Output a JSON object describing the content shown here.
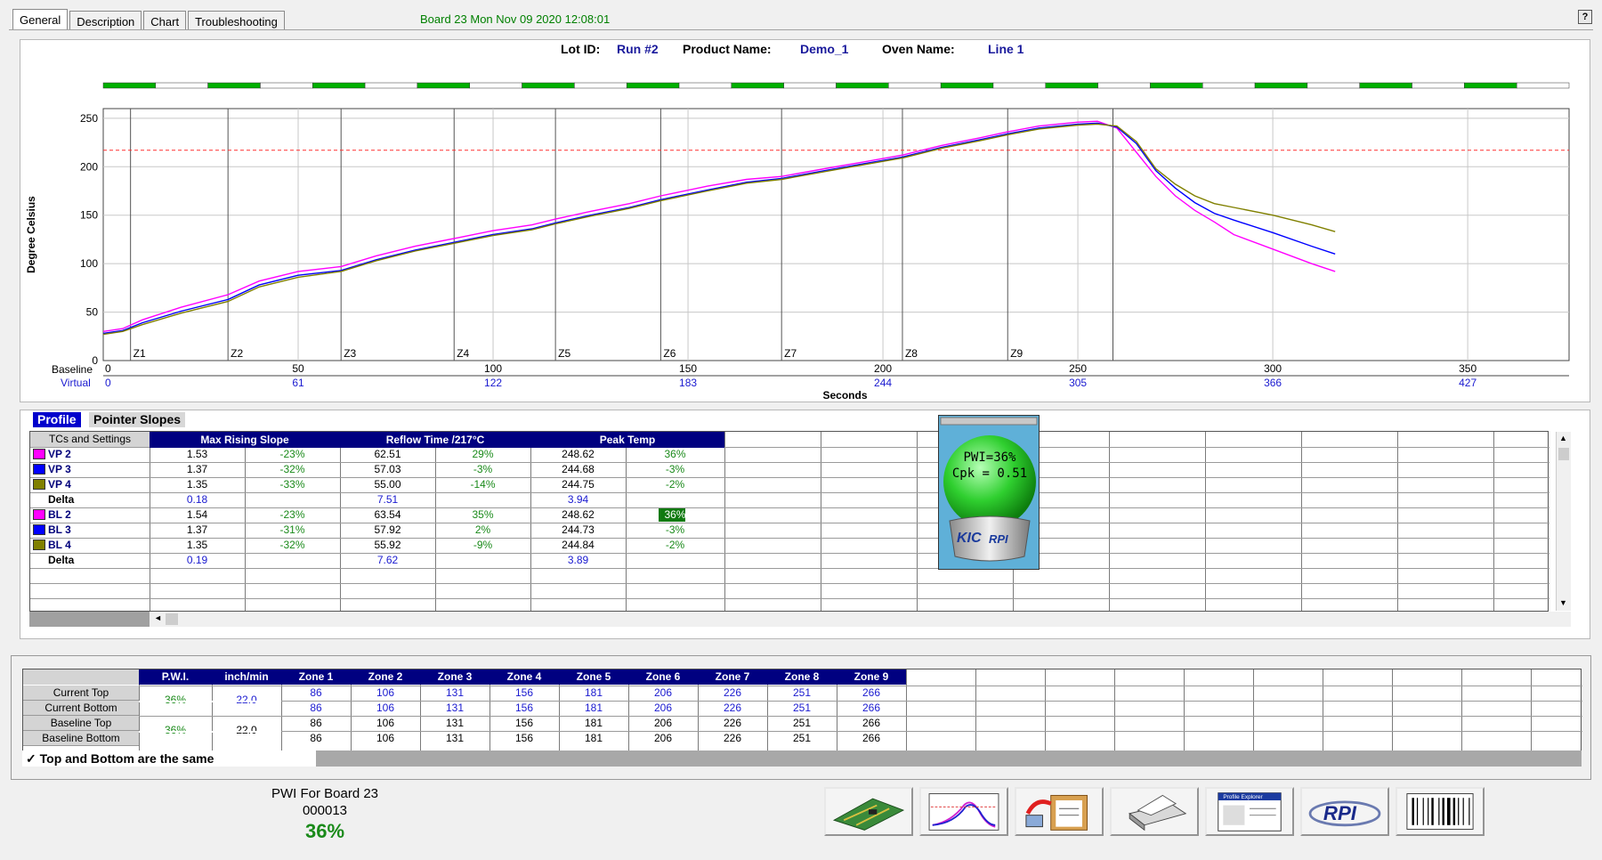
{
  "tabs": [
    "General",
    "Description",
    "Chart",
    "Troubleshooting"
  ],
  "header_status": "Board 23   Mon Nov 09 2020 12:08:01",
  "help_label": "?",
  "lot": {
    "lot_id_label": "Lot ID:",
    "lot_id": "Run #2",
    "product_label": "Product Name:",
    "product": "Demo_1",
    "oven_label": "Oven Name:",
    "oven": "Line 1"
  },
  "chart_data": {
    "type": "line",
    "ylabel": "Degree Celsius",
    "xlabel": "Seconds",
    "ylim": [
      0,
      260
    ],
    "xlim": [
      0,
      376
    ],
    "yticks": [
      0,
      50,
      100,
      150,
      200,
      250
    ],
    "baseline_label": "Baseline",
    "virtual_label": "Virtual",
    "baseline_ticks": [
      0,
      50,
      100,
      150,
      200,
      250,
      300,
      350
    ],
    "virtual_ticks": [
      0,
      61,
      122,
      183,
      244,
      305,
      366,
      427
    ],
    "reference_line": 217,
    "zones": [
      {
        "label": "Z1",
        "x": 7
      },
      {
        "label": "Z2",
        "x": 32
      },
      {
        "label": "Z3",
        "x": 61
      },
      {
        "label": "Z4",
        "x": 90
      },
      {
        "label": "Z5",
        "x": 116
      },
      {
        "label": "Z6",
        "x": 143
      },
      {
        "label": "Z7",
        "x": 174
      },
      {
        "label": "Z8",
        "x": 205
      },
      {
        "label": "Z9",
        "x": 232
      }
    ],
    "series": [
      {
        "color": "#ff00ff",
        "x": [
          0,
          5,
          10,
          20,
          32,
          40,
          50,
          61,
          70,
          80,
          90,
          100,
          110,
          116,
          125,
          135,
          143,
          155,
          165,
          174,
          185,
          195,
          205,
          215,
          225,
          232,
          240,
          250,
          255,
          260,
          265,
          270,
          275,
          280,
          285,
          290,
          300,
          310,
          316
        ],
        "y": [
          30,
          33,
          42,
          55,
          68,
          82,
          92,
          97,
          108,
          118,
          126,
          134,
          140,
          146,
          154,
          162,
          170,
          180,
          187,
          190,
          198,
          205,
          212,
          222,
          230,
          236,
          242,
          246,
          247,
          240,
          215,
          190,
          170,
          155,
          143,
          130,
          115,
          100,
          92
        ]
      },
      {
        "color": "#0000ff",
        "x": [
          0,
          5,
          10,
          20,
          32,
          40,
          50,
          61,
          70,
          80,
          90,
          100,
          110,
          116,
          125,
          135,
          143,
          155,
          165,
          174,
          185,
          195,
          205,
          215,
          225,
          232,
          240,
          250,
          255,
          260,
          265,
          270,
          275,
          280,
          285,
          290,
          300,
          310,
          316
        ],
        "y": [
          28,
          31,
          39,
          51,
          63,
          78,
          88,
          93,
          104,
          114,
          122,
          130,
          136,
          142,
          150,
          158,
          166,
          176,
          184,
          188,
          196,
          203,
          210,
          220,
          228,
          234,
          240,
          244,
          245,
          241,
          224,
          196,
          178,
          163,
          152,
          145,
          132,
          118,
          110
        ]
      },
      {
        "color": "#808000",
        "x": [
          0,
          5,
          10,
          20,
          32,
          40,
          50,
          61,
          70,
          80,
          90,
          100,
          110,
          116,
          125,
          135,
          143,
          155,
          165,
          174,
          185,
          195,
          205,
          215,
          225,
          232,
          240,
          250,
          255,
          260,
          265,
          270,
          275,
          280,
          285,
          290,
          300,
          310,
          316
        ],
        "y": [
          27,
          30,
          37,
          49,
          61,
          76,
          86,
          92,
          103,
          113,
          121,
          129,
          135,
          141,
          149,
          157,
          165,
          175,
          183,
          187,
          195,
          202,
          209,
          219,
          227,
          233,
          239,
          243,
          244,
          242,
          226,
          198,
          182,
          170,
          162,
          158,
          150,
          140,
          133
        ]
      }
    ],
    "segment_bar": [
      true,
      false,
      true,
      false,
      true,
      false,
      true,
      false,
      true,
      false,
      true,
      false,
      true,
      false,
      true,
      false,
      true,
      false,
      true,
      false,
      true,
      false,
      true,
      false,
      true,
      false,
      true,
      false
    ]
  },
  "profile": {
    "tab_active": "Profile",
    "tab_inactive": "Pointer Slopes",
    "col0_header": "TCs and Settings",
    "headers": [
      "Max Rising Slope",
      "Reflow Time /217°C",
      "Peak Temp"
    ],
    "rows": [
      {
        "name": "VP 2",
        "color": "#ff00ff",
        "vals": [
          "1.53",
          "-23%",
          "62.51",
          "29%",
          "248.62",
          "36%"
        ],
        "kind": "tc"
      },
      {
        "name": "VP 3",
        "color": "#0000ff",
        "vals": [
          "1.37",
          "-32%",
          "57.03",
          "-3%",
          "244.68",
          "-3%"
        ],
        "kind": "tc"
      },
      {
        "name": "VP 4",
        "color": "#808000",
        "vals": [
          "1.35",
          "-33%",
          "55.00",
          "-14%",
          "244.75",
          "-2%"
        ],
        "kind": "tc"
      },
      {
        "name": "Delta",
        "color": "",
        "vals": [
          "0.18",
          "",
          "7.51",
          "",
          "3.94",
          ""
        ],
        "kind": "delta"
      },
      {
        "name": "BL 2",
        "color": "#ff00ff",
        "vals": [
          "1.54",
          "-23%",
          "63.54",
          "35%",
          "248.62",
          "36%"
        ],
        "kind": "tc",
        "highlight": 5
      },
      {
        "name": "BL 3",
        "color": "#0000ff",
        "vals": [
          "1.37",
          "-31%",
          "57.92",
          "2%",
          "244.73",
          "-3%"
        ],
        "kind": "tc"
      },
      {
        "name": "BL 4",
        "color": "#808000",
        "vals": [
          "1.35",
          "-32%",
          "55.92",
          "-9%",
          "244.84",
          "-2%"
        ],
        "kind": "tc"
      },
      {
        "name": "Delta",
        "color": "",
        "vals": [
          "0.19",
          "",
          "7.62",
          "",
          "3.89",
          ""
        ],
        "kind": "delta"
      }
    ]
  },
  "globe": {
    "pwi": "PWI=36%",
    "cpk": "Cpk = 0.51",
    "logo": "KIC",
    "logo2": "RPI"
  },
  "settings": {
    "headers": [
      "P.W.I.",
      "inch/min",
      "Zone 1",
      "Zone 2",
      "Zone 3",
      "Zone 4",
      "Zone 5",
      "Zone 6",
      "Zone 7",
      "Zone 8",
      "Zone 9"
    ],
    "row_labels": [
      "Current Top",
      "Current Bottom",
      "Baseline Top",
      "Baseline Bottom"
    ],
    "pwi_current": "36%",
    "speed_current": "22.0",
    "pwi_baseline": "36%",
    "speed_baseline": "22.0",
    "zones": [
      [
        "86",
        "106",
        "131",
        "156",
        "181",
        "206",
        "226",
        "251",
        "266"
      ],
      [
        "86",
        "106",
        "131",
        "156",
        "181",
        "206",
        "226",
        "251",
        "266"
      ],
      [
        "86",
        "106",
        "131",
        "156",
        "181",
        "206",
        "226",
        "251",
        "266"
      ],
      [
        "86",
        "106",
        "131",
        "156",
        "181",
        "206",
        "226",
        "251",
        "266"
      ]
    ],
    "checkbox_label": "Top and Bottom are the same",
    "checkbox_checked": true,
    "checkbox_mark": "✓"
  },
  "footer": {
    "title": "PWI For Board 23",
    "id": "000013",
    "pwi": "36%"
  },
  "toolbar": [
    "circuit-board-button",
    "profile-chart-button",
    "clipboard-export-button",
    "print-button",
    "profile-explorer-button",
    "rpi-button",
    "barcode-button"
  ],
  "toolbar_text": {
    "profile_explorer": "Profile Explorer",
    "rpi": "RPI"
  }
}
